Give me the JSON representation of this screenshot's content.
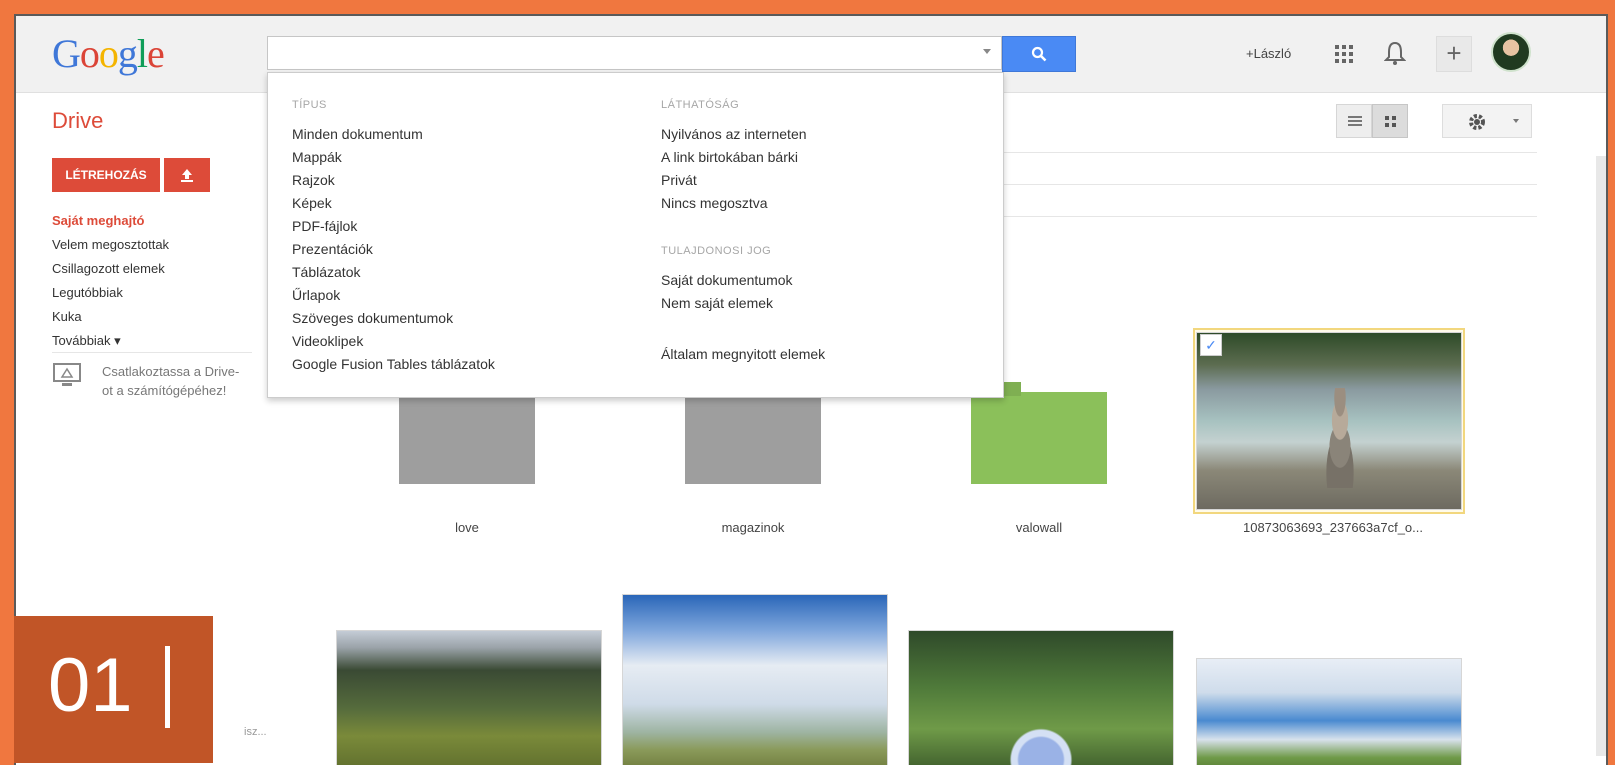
{
  "header": {
    "logo": {
      "G": "G",
      "o1": "o",
      "o2": "o",
      "g": "g",
      "l": "l",
      "e": "e"
    },
    "search": {
      "value": "",
      "placeholder": ""
    },
    "user_link": "+László",
    "icons": [
      "search-icon",
      "apps-grid-icon",
      "bell-icon",
      "plus-icon",
      "avatar"
    ]
  },
  "drive": {
    "title": "Drive"
  },
  "sidebar": {
    "create_label": "LÉTREHOZÁS",
    "items": [
      {
        "label": "Saját meghajtó",
        "active": true
      },
      {
        "label": "Velem megosztottak"
      },
      {
        "label": "Csillagozott elemek"
      },
      {
        "label": "Legutóbbiak"
      },
      {
        "label": "Kuka"
      },
      {
        "label": "Továbbiak ▾"
      }
    ],
    "connect_text": "Csatlakoztassa a Drive-ot a számítógépéhez!"
  },
  "dropdown": {
    "type_header": "TÍPUS",
    "types": [
      "Minden dokumentum",
      "Mappák",
      "Rajzok",
      "Képek",
      "PDF-fájlok",
      "Prezentációk",
      "Táblázatok",
      "Űrlapok",
      "Szöveges dokumentumok",
      "Videoklipek",
      "Google Fusion Tables táblázatok"
    ],
    "visibility_header": "LÁTHATÓSÁG",
    "visibility": [
      "Nyilvános az interneten",
      "A link birtokában bárki",
      "Privát",
      "Nincs megosztva"
    ],
    "ownership_header": "TULAJDONOSI JOG",
    "ownership": [
      "Saját dokumentumok",
      "Nem saját elemek"
    ],
    "opened": "Általam megnyitott elemek"
  },
  "files": [
    {
      "name": "love",
      "kind": "folder",
      "color": "#9e9e9e"
    },
    {
      "name": "magazinok",
      "kind": "folder",
      "color": "#9e9e9e"
    },
    {
      "name": "valowall",
      "kind": "folder",
      "color": "#8bc05a"
    },
    {
      "name": "10873063693_237663a7cf_o...",
      "kind": "image",
      "selected": true
    }
  ],
  "badge": {
    "number": "01"
  },
  "faint_text": "isz..."
}
